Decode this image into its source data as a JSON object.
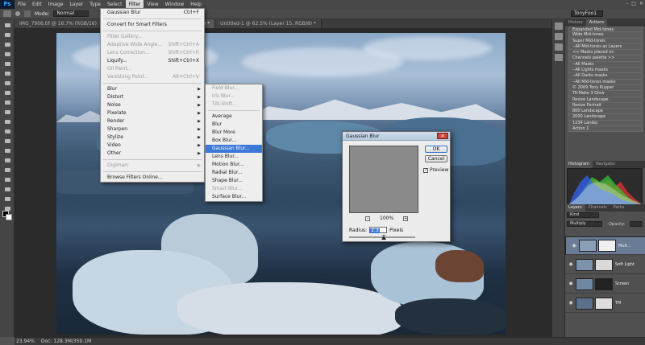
{
  "menubar": {
    "logo": "Ps",
    "items": [
      "File",
      "Edit",
      "Image",
      "Layer",
      "Type",
      "Select",
      "Filter",
      "View",
      "Window",
      "Help"
    ],
    "active_index": 6
  },
  "options": {
    "mode_label": "Mode:",
    "mode_value": "Normal",
    "workspace": "TonyFoo1"
  },
  "tabs": [
    "IMG_7906.tif @ 16.7% (RGB/16)",
    "IMG_7906.tif @ 16.7% (Layer 15, RGB/8) *",
    "Untitled-1 @ 62.5% (Layer 15, RGB/8) *"
  ],
  "active_tab_index": 1,
  "status": {
    "zoom": "23.94%",
    "doc": "Doc: 128.3M/359.1M"
  },
  "filter_menu": {
    "items": [
      {
        "label": "Gaussian Blur",
        "shortcut": "Ctrl+F",
        "disabled": false
      },
      {
        "sep": true
      },
      {
        "label": "Convert for Smart Filters",
        "shortcut": "",
        "disabled": false
      },
      {
        "sep": true
      },
      {
        "label": "Filter Gallery...",
        "shortcut": "",
        "disabled": true
      },
      {
        "label": "Adaptive Wide Angle...",
        "shortcut": "Shift+Ctrl+A",
        "disabled": true
      },
      {
        "label": "Lens Correction...",
        "shortcut": "Shift+Ctrl+R",
        "disabled": true
      },
      {
        "label": "Liquify...",
        "shortcut": "Shift+Ctrl+X",
        "disabled": false
      },
      {
        "label": "Oil Paint...",
        "shortcut": "",
        "disabled": true
      },
      {
        "label": "Vanishing Point...",
        "shortcut": "Alt+Ctrl+V",
        "disabled": true
      },
      {
        "sep": true
      },
      {
        "label": "Blur",
        "arrow": true,
        "disabled": false
      },
      {
        "label": "Distort",
        "arrow": true,
        "disabled": false
      },
      {
        "label": "Noise",
        "arrow": true,
        "disabled": false
      },
      {
        "label": "Pixelate",
        "arrow": true,
        "disabled": false
      },
      {
        "label": "Render",
        "arrow": true,
        "disabled": false
      },
      {
        "label": "Sharpen",
        "arrow": true,
        "disabled": false
      },
      {
        "label": "Stylize",
        "arrow": true,
        "disabled": false
      },
      {
        "label": "Video",
        "arrow": true,
        "disabled": false
      },
      {
        "label": "Other",
        "arrow": true,
        "disabled": false
      },
      {
        "sep": true
      },
      {
        "label": "Digimarc",
        "arrow": true,
        "disabled": true
      },
      {
        "sep": true
      },
      {
        "label": "Browse Filters Online...",
        "shortcut": "",
        "disabled": false
      }
    ]
  },
  "blur_submenu": {
    "items": [
      {
        "label": "Field Blur...",
        "disabled": true
      },
      {
        "label": "Iris Blur...",
        "disabled": true
      },
      {
        "label": "Tilt-Shift...",
        "disabled": true
      },
      {
        "sep": true
      },
      {
        "label": "Average",
        "disabled": false
      },
      {
        "label": "Blur",
        "disabled": false
      },
      {
        "label": "Blur More",
        "disabled": false
      },
      {
        "label": "Box Blur...",
        "disabled": false
      },
      {
        "label": "Gaussian Blur...",
        "disabled": false,
        "highlight": true
      },
      {
        "label": "Lens Blur...",
        "disabled": false
      },
      {
        "label": "Motion Blur...",
        "disabled": false
      },
      {
        "label": "Radial Blur...",
        "disabled": false
      },
      {
        "label": "Shape Blur...",
        "disabled": false
      },
      {
        "label": "Smart Blur...",
        "disabled": true
      },
      {
        "label": "Surface Blur...",
        "disabled": false
      }
    ]
  },
  "dialog": {
    "title": "Gaussian Blur",
    "ok": "OK",
    "cancel": "Cancel",
    "preview": "Preview",
    "preview_checked": true,
    "zoom": "100%",
    "radius_label": "Radius:",
    "radius_value": "2.3",
    "radius_unit": "Pixels"
  },
  "panels": {
    "tabs_top": [
      "History",
      "Actions"
    ],
    "actions": [
      "Expanded Mid-tones",
      "Wide Mid-tones",
      "Super Mid-tones",
      "--All Mid-tones as Layers",
      "<< Masks placed on",
      "Channels palette >>",
      "--All Masks",
      "--All Lights masks",
      "--All Darks masks",
      "--All Mid-tones masks",
      "© 2009 Tony Kuyper",
      "TK-Make 3 Glow",
      "Resize Landscape",
      "Resize Portrait",
      "800 Landscape",
      "2000 Landscape",
      "1234 Landsc",
      "Action 1"
    ],
    "tabs_hist": [
      "Histogram",
      "Navigator"
    ],
    "tabs_layers": [
      "Layers",
      "Channels",
      "Paths"
    ],
    "kind_label": "Kind",
    "blend_mode": "Multiply",
    "opacity_label": "Opacity:",
    "layers": [
      {
        "name": "Mult...",
        "selected": true
      },
      {
        "name": "Soft Light",
        "selected": false
      },
      {
        "name": "Screen",
        "selected": false
      },
      {
        "name": "TM",
        "selected": false
      }
    ]
  }
}
